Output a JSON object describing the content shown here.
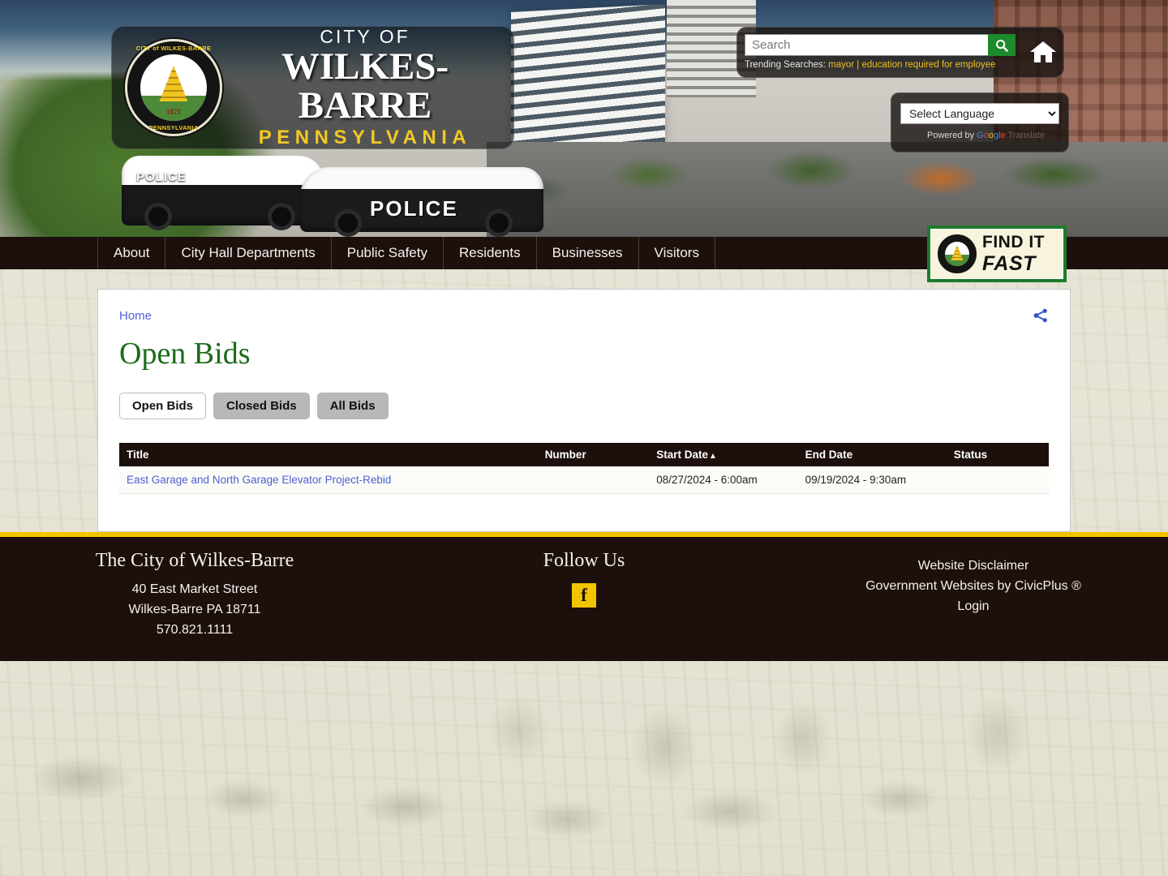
{
  "hero": {
    "logo": {
      "city_of": "CITY OF",
      "city_name": "WILKES-BARRE",
      "state": "PENNSYLVANIA",
      "seal_top_text": "CITY of WILKES-BARRE",
      "seal_bottom_text": "PENNSYLVANIA",
      "seal_year": "1871"
    },
    "search": {
      "placeholder": "Search",
      "value": "",
      "button_icon": "search-icon",
      "trending_label": "Trending Searches:",
      "trending_items": [
        "mayor",
        "education required for employee"
      ],
      "trending_separator": "|"
    },
    "home_icon": "home-icon",
    "language": {
      "selected": "Select Language",
      "options": [
        "Select Language"
      ],
      "powered_by": "Powered by",
      "google": "Google",
      "translate": "Translate"
    }
  },
  "nav": {
    "items": [
      {
        "label": "About"
      },
      {
        "label": "City Hall Departments"
      },
      {
        "label": "Public Safety"
      },
      {
        "label": "Residents"
      },
      {
        "label": "Businesses"
      },
      {
        "label": "Visitors"
      }
    ]
  },
  "find_it_fast": {
    "line1": "FIND IT",
    "line2": "FAST"
  },
  "main": {
    "breadcrumb": "Home",
    "share_icon": "share-icon",
    "title": "Open Bids",
    "tabs": [
      {
        "label": "Open Bids",
        "active": true
      },
      {
        "label": "Closed Bids",
        "active": false
      },
      {
        "label": "All Bids",
        "active": false
      }
    ],
    "table": {
      "columns": [
        "Title",
        "Number",
        "Start Date",
        "End Date",
        "Status"
      ],
      "sorted_column": "Start Date",
      "sort_direction": "ascending",
      "sort_caret": "▲",
      "rows": [
        {
          "title": "East Garage and North Garage Elevator Project-Rebid",
          "number": "",
          "start_date": "08/27/2024 - 6:00am",
          "end_date": "09/19/2024 - 9:30am",
          "status": ""
        }
      ]
    }
  },
  "footer": {
    "address_heading": "The City of Wilkes-Barre",
    "address_line1": "40 East Market Street",
    "address_line2": "Wilkes-Barre PA 18711",
    "phone": "570.821.1111",
    "follow_heading": "Follow Us",
    "facebook_icon": "facebook-icon",
    "facebook_glyph": "f",
    "links": [
      {
        "label": "Website Disclaimer"
      },
      {
        "label": "Government Websites by CivicPlus ®"
      },
      {
        "label": "Login"
      }
    ]
  },
  "colors": {
    "nav_bar": "#1d100c",
    "accent_yellow": "#f2c400",
    "title_green": "#1b6b18",
    "link_blue": "#4d61d4",
    "search_button_green": "#1d8a2b",
    "page_background": "#e6e3d3"
  }
}
